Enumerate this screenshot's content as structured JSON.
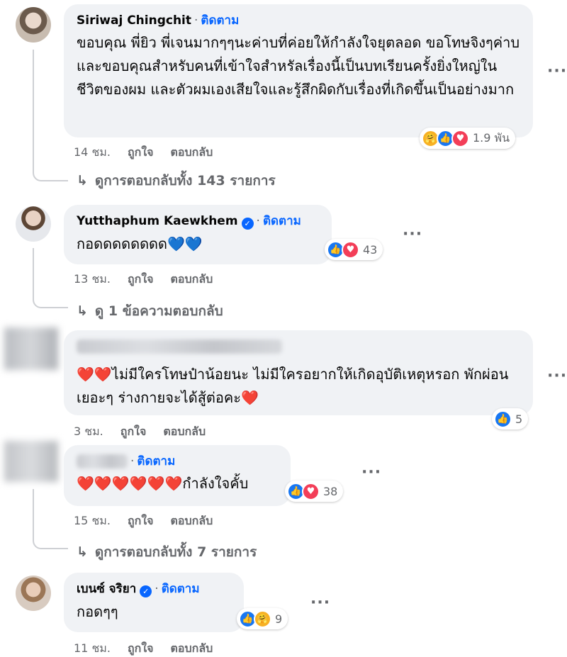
{
  "follow_label": "ติดตาม",
  "like_label": "ถูกใจ",
  "reply_label": "ตอบกลับ",
  "more_label": "···",
  "comments": [
    {
      "name": "Siriwaj Chingchit",
      "verified": false,
      "text": "ขอบคุณ พี่ยิว พี่เจนมากๆๆนะค่าบที่ค่อยให้กำลังใจยุตลอด ขอโทษจิงๆค่าบและขอบคุณสำหรับคนที่เข้าใจสำหรัลเรื่องนี้เป็นบทเรียนครั้งยิ่งใหญ่ในชีวิตของผม และตัวผมเองเสียใจและรู้สึกผิดกับเรื่องที่เกิดขึ้นเป็นอย่างมาก",
      "time": "14 ชม.",
      "reactions": [
        "care",
        "like",
        "love"
      ],
      "reaction_count": "1.9 พัน",
      "replies": "ดูการตอบกลับทั้ง 143 รายการ"
    },
    {
      "name": "Yutthaphum Kaewkhem",
      "verified": true,
      "text": "กอดดดดดดดด💙💙",
      "time": "13 ชม.",
      "reactions": [
        "like",
        "love"
      ],
      "reaction_count": "43",
      "replies": "ดู 1 ข้อความตอบกลับ"
    },
    {
      "name": "",
      "verified": false,
      "text": "❤️❤️ไม่มีใครโทษป๋าน้อยนะ ไม่มีใครอยากให้เกิดอุบัติเหตุหรอก พักผ่อนเยอะๆ ร่างกายจะได้สู้ต่อคะ❤️",
      "time": "3 ชม.",
      "reactions": [
        "like"
      ],
      "reaction_count": "5",
      "replies": ""
    },
    {
      "name": "",
      "verified": false,
      "text": "❤️❤️❤️❤️❤️❤️กำลังใจคั้บ",
      "time": "15 ชม.",
      "reactions": [
        "like",
        "love"
      ],
      "reaction_count": "38",
      "replies": "ดูการตอบกลับทั้ง 7 รายการ"
    },
    {
      "name": "เบนซ์ จริยา",
      "verified": true,
      "text": "กอดๆๆ",
      "time": "11 ชม.",
      "reactions": [
        "like",
        "care"
      ],
      "reaction_count": "9",
      "replies": ""
    }
  ]
}
